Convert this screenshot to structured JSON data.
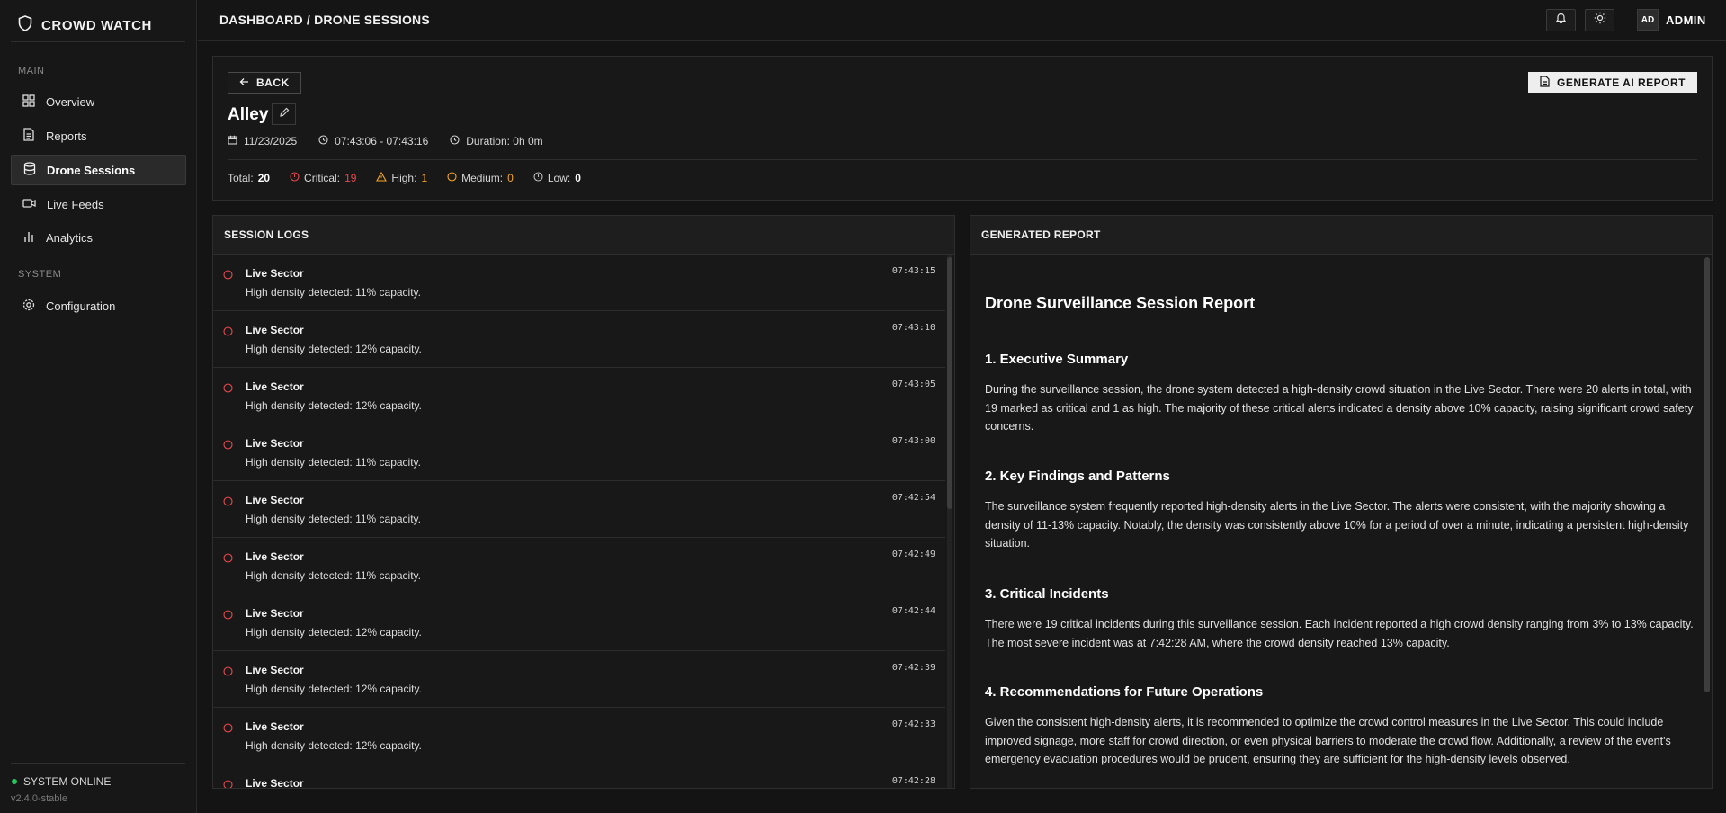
{
  "sidebar": {
    "brand": "CROWD WATCH",
    "main_label": "MAIN",
    "system_label": "SYSTEM",
    "items": [
      {
        "label": "Overview",
        "icon": "grid-icon"
      },
      {
        "label": "Reports",
        "icon": "file-text-icon"
      },
      {
        "label": "Drone Sessions",
        "icon": "database-icon",
        "active": true
      },
      {
        "label": "Live Feeds",
        "icon": "video-icon"
      },
      {
        "label": "Analytics",
        "icon": "bar-chart-icon"
      }
    ],
    "config_label": "Configuration",
    "status": "SYSTEM ONLINE",
    "version": "v2.4.0-stable"
  },
  "topbar": {
    "breadcrumb": "DASHBOARD / DRONE SESSIONS",
    "avatar_initials": "AD",
    "user": "ADMIN"
  },
  "session": {
    "back_label": "BACK",
    "generate_label": "GENERATE AI REPORT",
    "title": "Alley",
    "date": "11/23/2025",
    "time_range": "07:43:06 - 07:43:16",
    "duration": "Duration: 0h 0m",
    "counts": {
      "total_label": "Total:",
      "total": "20",
      "critical_label": "Critical:",
      "critical": "19",
      "high_label": "High:",
      "high": "1",
      "medium_label": "Medium:",
      "medium": "0",
      "low_label": "Low:",
      "low": "0"
    }
  },
  "logs": {
    "title": "SESSION LOGS",
    "items": [
      {
        "sector": "Live Sector",
        "message": "High density detected: 11% capacity.",
        "time": "07:43:15"
      },
      {
        "sector": "Live Sector",
        "message": "High density detected: 12% capacity.",
        "time": "07:43:10"
      },
      {
        "sector": "Live Sector",
        "message": "High density detected: 12% capacity.",
        "time": "07:43:05"
      },
      {
        "sector": "Live Sector",
        "message": "High density detected: 11% capacity.",
        "time": "07:43:00"
      },
      {
        "sector": "Live Sector",
        "message": "High density detected: 11% capacity.",
        "time": "07:42:54"
      },
      {
        "sector": "Live Sector",
        "message": "High density detected: 11% capacity.",
        "time": "07:42:49"
      },
      {
        "sector": "Live Sector",
        "message": "High density detected: 12% capacity.",
        "time": "07:42:44"
      },
      {
        "sector": "Live Sector",
        "message": "High density detected: 12% capacity.",
        "time": "07:42:39"
      },
      {
        "sector": "Live Sector",
        "message": "High density detected: 12% capacity.",
        "time": "07:42:33"
      },
      {
        "sector": "Live Sector",
        "message": "",
        "time": "07:42:28"
      }
    ]
  },
  "report": {
    "panel_title": "GENERATED REPORT",
    "title": "Drone Surveillance Session Report",
    "sections": [
      {
        "heading": "1. Executive Summary",
        "body": "During the surveillance session, the drone system detected a high-density crowd situation in the Live Sector. There were 20 alerts in total, with 19 marked as critical and 1 as high. The majority of these critical alerts indicated a density above 10% capacity, raising significant crowd safety concerns."
      },
      {
        "heading": "2. Key Findings and Patterns",
        "body": "The surveillance system frequently reported high-density alerts in the Live Sector. The alerts were consistent, with the majority showing a density of 11-13% capacity. Notably, the density was consistently above 10% for a period of over a minute, indicating a persistent high-density situation."
      },
      {
        "heading": "3. Critical Incidents",
        "body": "There were 19 critical incidents during this surveillance session. Each incident reported a high crowd density ranging from 3% to 13% capacity. The most severe incident was at 7:42:28 AM, where the crowd density reached 13% capacity."
      },
      {
        "heading": "4. Recommendations for Future Operations",
        "body": "Given the consistent high-density alerts, it is recommended to optimize the crowd control measures in the Live Sector. This could include improved signage, more staff for crowd direction, or even physical barriers to moderate the crowd flow. Additionally, a review of the event's emergency evacuation procedures would be prudent, ensuring they are sufficient for the high-density levels observed."
      }
    ]
  },
  "colors": {
    "critical": "#e5484d",
    "high": "#f5a524",
    "online": "#22c55e"
  }
}
